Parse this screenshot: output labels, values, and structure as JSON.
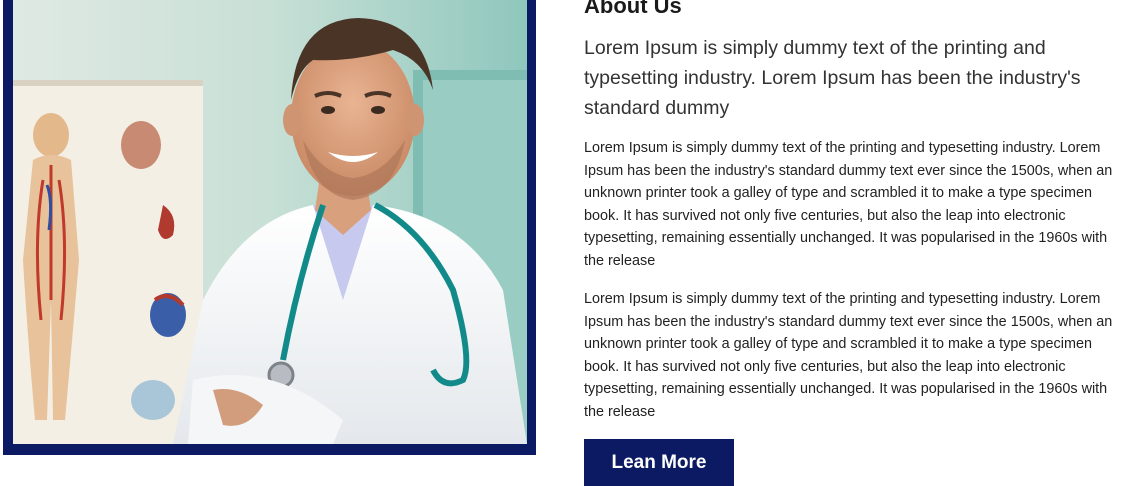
{
  "about": {
    "title": "About Us",
    "lead": "Lorem Ipsum is simply dummy text of the printing and typesetting industry. Lorem Ipsum has been the industry's standard dummy",
    "paragraphs": [
      "Lorem Ipsum is simply dummy text of the printing and typesetting industry. Lorem Ipsum has been the industry's standard dummy text ever since the 1500s, when an unknown printer took a galley of type and scrambled it to make a type specimen book. It has survived not only five centuries, but also the leap into electronic typesetting, remaining essentially unchanged. It was popularised in the 1960s with the release",
      "Lorem Ipsum is simply dummy text of the printing and typesetting industry. Lorem Ipsum has been the industry's standard dummy text ever since the 1500s, when an unknown printer took a galley of type and scrambled it to make a type specimen book. It has survived not only five centuries, but also the leap into electronic typesetting, remaining essentially unchanged. It was popularised in the 1960s with the release"
    ],
    "button_label": "Lean More"
  },
  "colors": {
    "brand": "#0c1a63",
    "heading": "#1a1a1a",
    "text": "#222222"
  }
}
